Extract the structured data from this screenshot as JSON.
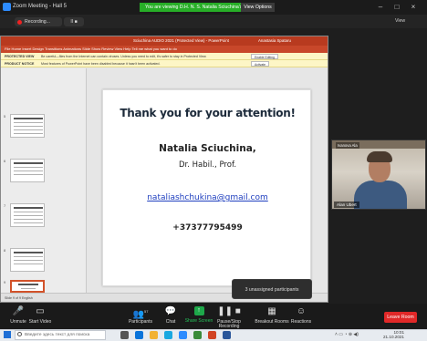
{
  "window": {
    "title": "Zoom Meeting - Hall 5"
  },
  "banner": {
    "text": "You are viewing D.H. N. S. Natalia Sciuchina's screen",
    "view_options": "View Options"
  },
  "recording": {
    "label": "Recording...",
    "controls": "II ■"
  },
  "top_right": {
    "view": "View"
  },
  "ppt": {
    "title_center": "Sciuchina AUDIO 2021 (Protected View) - PowerPoint",
    "title_user": "Anastasia Spataru",
    "ribbon": "File   Home   Insert   Design   Transitions   Animations   Slide Show   Review   View   Help   Tell me what you want to do",
    "warn1": {
      "head": "PROTECTED VIEW",
      "body": "Be careful—files from the Internet can contain viruses. Unless you need to edit, it's safer to stay in Protected View.",
      "button": "Enable Editing"
    },
    "warn2": {
      "head": "PRODUCT NOTICE",
      "body": "Most features of PowerPoint have been disabled because it hasn't been activated.",
      "button": "Activate"
    },
    "thumb_numbers": [
      "5",
      "6",
      "7",
      "8",
      "9"
    ],
    "status": "Slide 9 of 9   English"
  },
  "slide": {
    "heading": "Thank you for your attention!",
    "name": "Natalia Sciuchina,",
    "title": "Dr. Habil., Prof.",
    "email": "nataliashchukina@gmail.com",
    "phone": "+37377795499"
  },
  "participant": {
    "name": "Alan Ubert",
    "mic_label": "Ivanova Ala"
  },
  "toast": "3 unassigned participants",
  "toolbar": {
    "unmute": "Unmute",
    "video": "Start Video",
    "participants": "Participants",
    "participants_count": "57",
    "chat": "Chat",
    "share": "Share Screen",
    "pause": "Pause/Stop Recording",
    "breakout": "Breakout Rooms",
    "reactions": "Reactions",
    "leave": "Leave Room"
  },
  "taskbar": {
    "search_placeholder": "Введите здесь текст для поиска",
    "time": "10:01",
    "date": "21.10.2021"
  },
  "colors": {
    "zoom_blue": "#2d8cff",
    "banner_green": "#27ae27",
    "ppt_red": "#b83a1f",
    "leave_red": "#e02828"
  }
}
